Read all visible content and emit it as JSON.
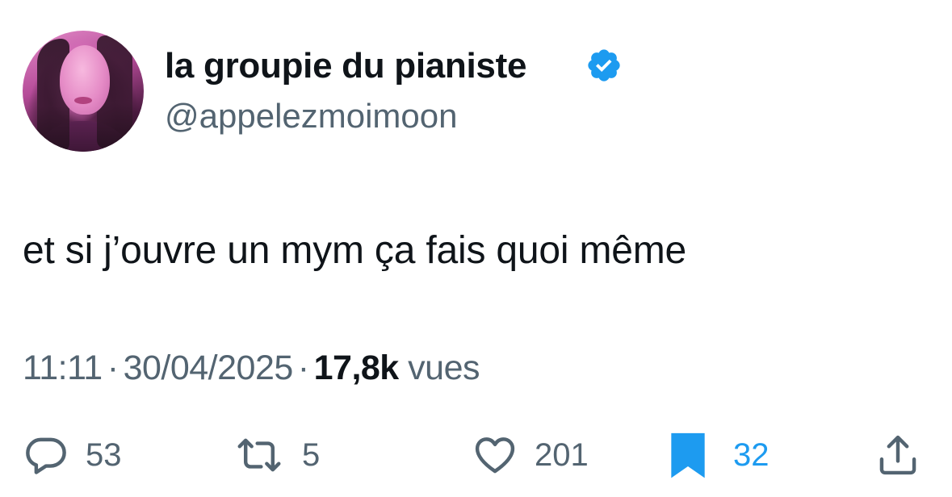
{
  "author": {
    "display_name": "la groupie du pianiste",
    "handle": "@appelezmoimoon",
    "verified": true
  },
  "tweet": {
    "text": "et si j’ouvre un mym ça fais quoi même"
  },
  "meta": {
    "time": "11:11",
    "separator": "·",
    "date": "30/04/2025",
    "views_count": "17,8k",
    "views_label": "vues"
  },
  "actions": {
    "replies": "53",
    "retweets": "5",
    "likes": "201",
    "bookmarks": "32",
    "bookmarked": true
  },
  "colors": {
    "text_primary": "#0f1419",
    "text_secondary": "#536471",
    "accent": "#1d9bf0"
  },
  "icons": {
    "reply": "speech-bubble-icon",
    "retweet": "retweet-arrows-icon",
    "like": "heart-outline-icon",
    "bookmark": "bookmark-filled-icon",
    "share": "share-upload-icon",
    "verified": "verified-badge-icon"
  }
}
